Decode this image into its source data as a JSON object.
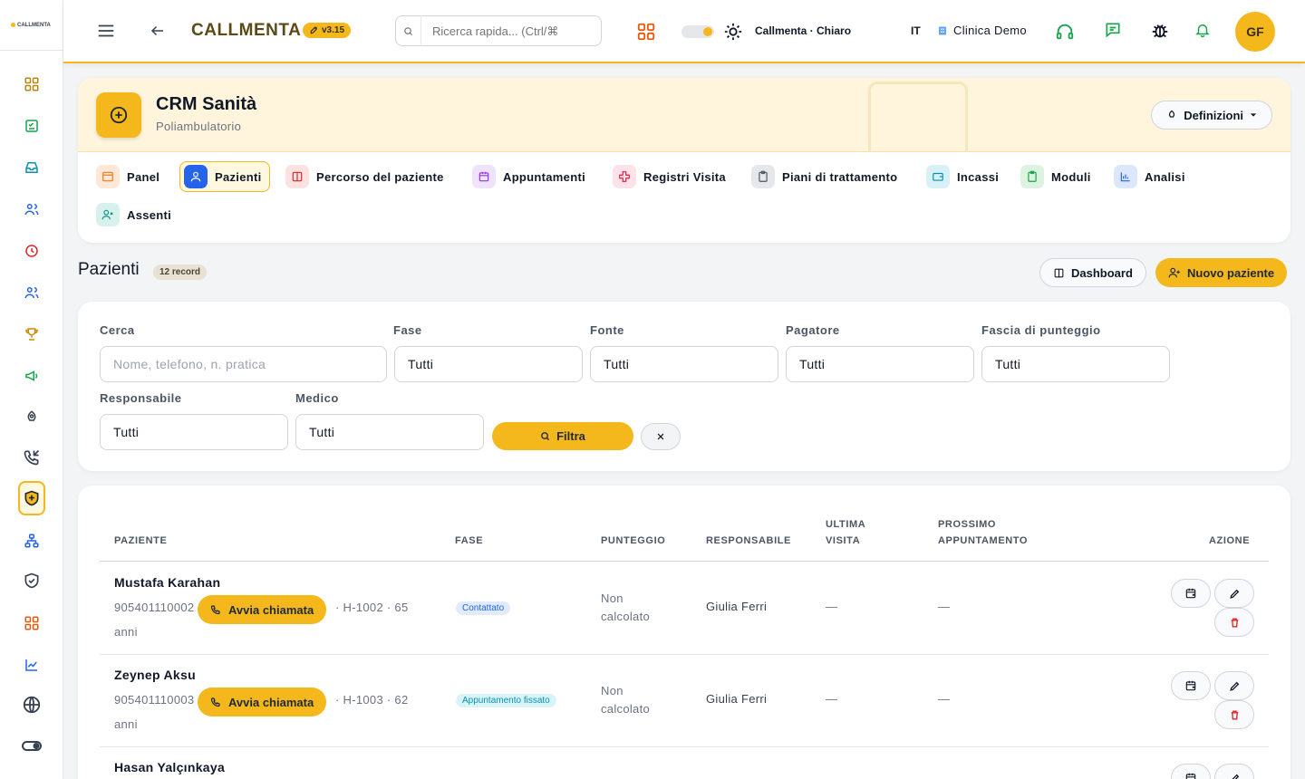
{
  "brand": {
    "logo_text": "CALLMENTA",
    "name": "CALLMENTA",
    "version": "v3.15"
  },
  "topbar": {
    "search_placeholder": "Ricerca rapida... (Ctrl/⌘",
    "theme_label": "Callmenta · Chiaro",
    "language": "IT",
    "clinic": "Clinica Demo",
    "avatar_initials": "GF"
  },
  "module": {
    "title": "CRM Sanità",
    "subtitle": "Poliambulatorio",
    "definitions_label": "Definizioni"
  },
  "tabs": [
    {
      "label": "Panel",
      "icon": "browser-icon",
      "color": "#f97316",
      "bg": "#fde8d7"
    },
    {
      "label": "Pazienti",
      "icon": "user-icon",
      "color": "#ffffff",
      "bg": "#2563eb"
    },
    {
      "label": "Percorso del paziente",
      "icon": "columns-icon",
      "color": "#dc2626",
      "bg": "#fde2e2"
    },
    {
      "label": "Appuntamenti",
      "icon": "calendar-icon",
      "color": "#9333ea",
      "bg": "#efe3fb"
    },
    {
      "label": "Registri Visita",
      "icon": "medical-cross-icon",
      "color": "#e11d48",
      "bg": "#fde2ea"
    },
    {
      "label": "Piani di trattamento",
      "icon": "clipboard-icon",
      "color": "#4b5563",
      "bg": "#e5e7eb"
    },
    {
      "label": "Incassi",
      "icon": "wallet-icon",
      "color": "#0891b2",
      "bg": "#d8f1f6"
    },
    {
      "label": "Moduli",
      "icon": "clipboard-check-icon",
      "color": "#16a34a",
      "bg": "#dcf3e2"
    },
    {
      "label": "Analisi",
      "icon": "chart-bar-icon",
      "color": "#2563eb",
      "bg": "#dde7fb"
    },
    {
      "label": "Assenti",
      "icon": "user-x-icon",
      "color": "#0d9488",
      "bg": "#d7f1ec"
    }
  ],
  "list": {
    "title": "Pazienti",
    "record_count": "12 record",
    "dashboard_label": "Dashboard",
    "new_patient_label": "Nuovo paziente"
  },
  "filters": {
    "search_label": "Cerca",
    "search_placeholder": "Nome, telefono, n. pratica",
    "phase_label": "Fase",
    "phase_value": "Tutti",
    "source_label": "Fonte",
    "source_value": "Tutti",
    "payer_label": "Pagatore",
    "payer_value": "Tutti",
    "score_label": "Fascia di punteggio",
    "score_value": "Tutti",
    "owner_label": "Responsabile",
    "owner_value": "Tutti",
    "doctor_label": "Medico",
    "doctor_value": "Tutti",
    "filter_button": "Filtra"
  },
  "table": {
    "headers": {
      "patient": "PAZIENTE",
      "phase": "FASE",
      "score": "PUNTEGGIO",
      "owner": "RESPONSABILE",
      "last_visit_1": "ULTIMA",
      "last_visit_2": "VISITA",
      "next_appt_1": "PROSSIMO",
      "next_appt_2": "APPUNTAMENTO",
      "action": "AZIONE"
    },
    "call_label": "Avvia chiamata",
    "rows": [
      {
        "name": "Mustafa Karahan",
        "phone": "905401110002",
        "meta": "· H-1002 · 65",
        "age_unit": "anni",
        "phase": "Contattato",
        "phase_color": "#2563eb",
        "phase_bg": "#e0ecfb",
        "score_1": "Non",
        "score_2": "calcolato",
        "owner": "Giulia Ferri",
        "last_visit": "—",
        "next_appt": "—"
      },
      {
        "name": "Zeynep Aksu",
        "phone": "905401110003",
        "meta": "· H-1003 · 62",
        "age_unit": "anni",
        "phase": "Appuntamento fissato",
        "phase_color": "#0891b2",
        "phase_bg": "#d9f4f8",
        "score_1": "Non",
        "score_2": "calcolato",
        "owner": "Giulia Ferri",
        "last_visit": "—",
        "next_appt": "—"
      },
      {
        "name": "Hasan Yalçınkaya"
      }
    ]
  }
}
